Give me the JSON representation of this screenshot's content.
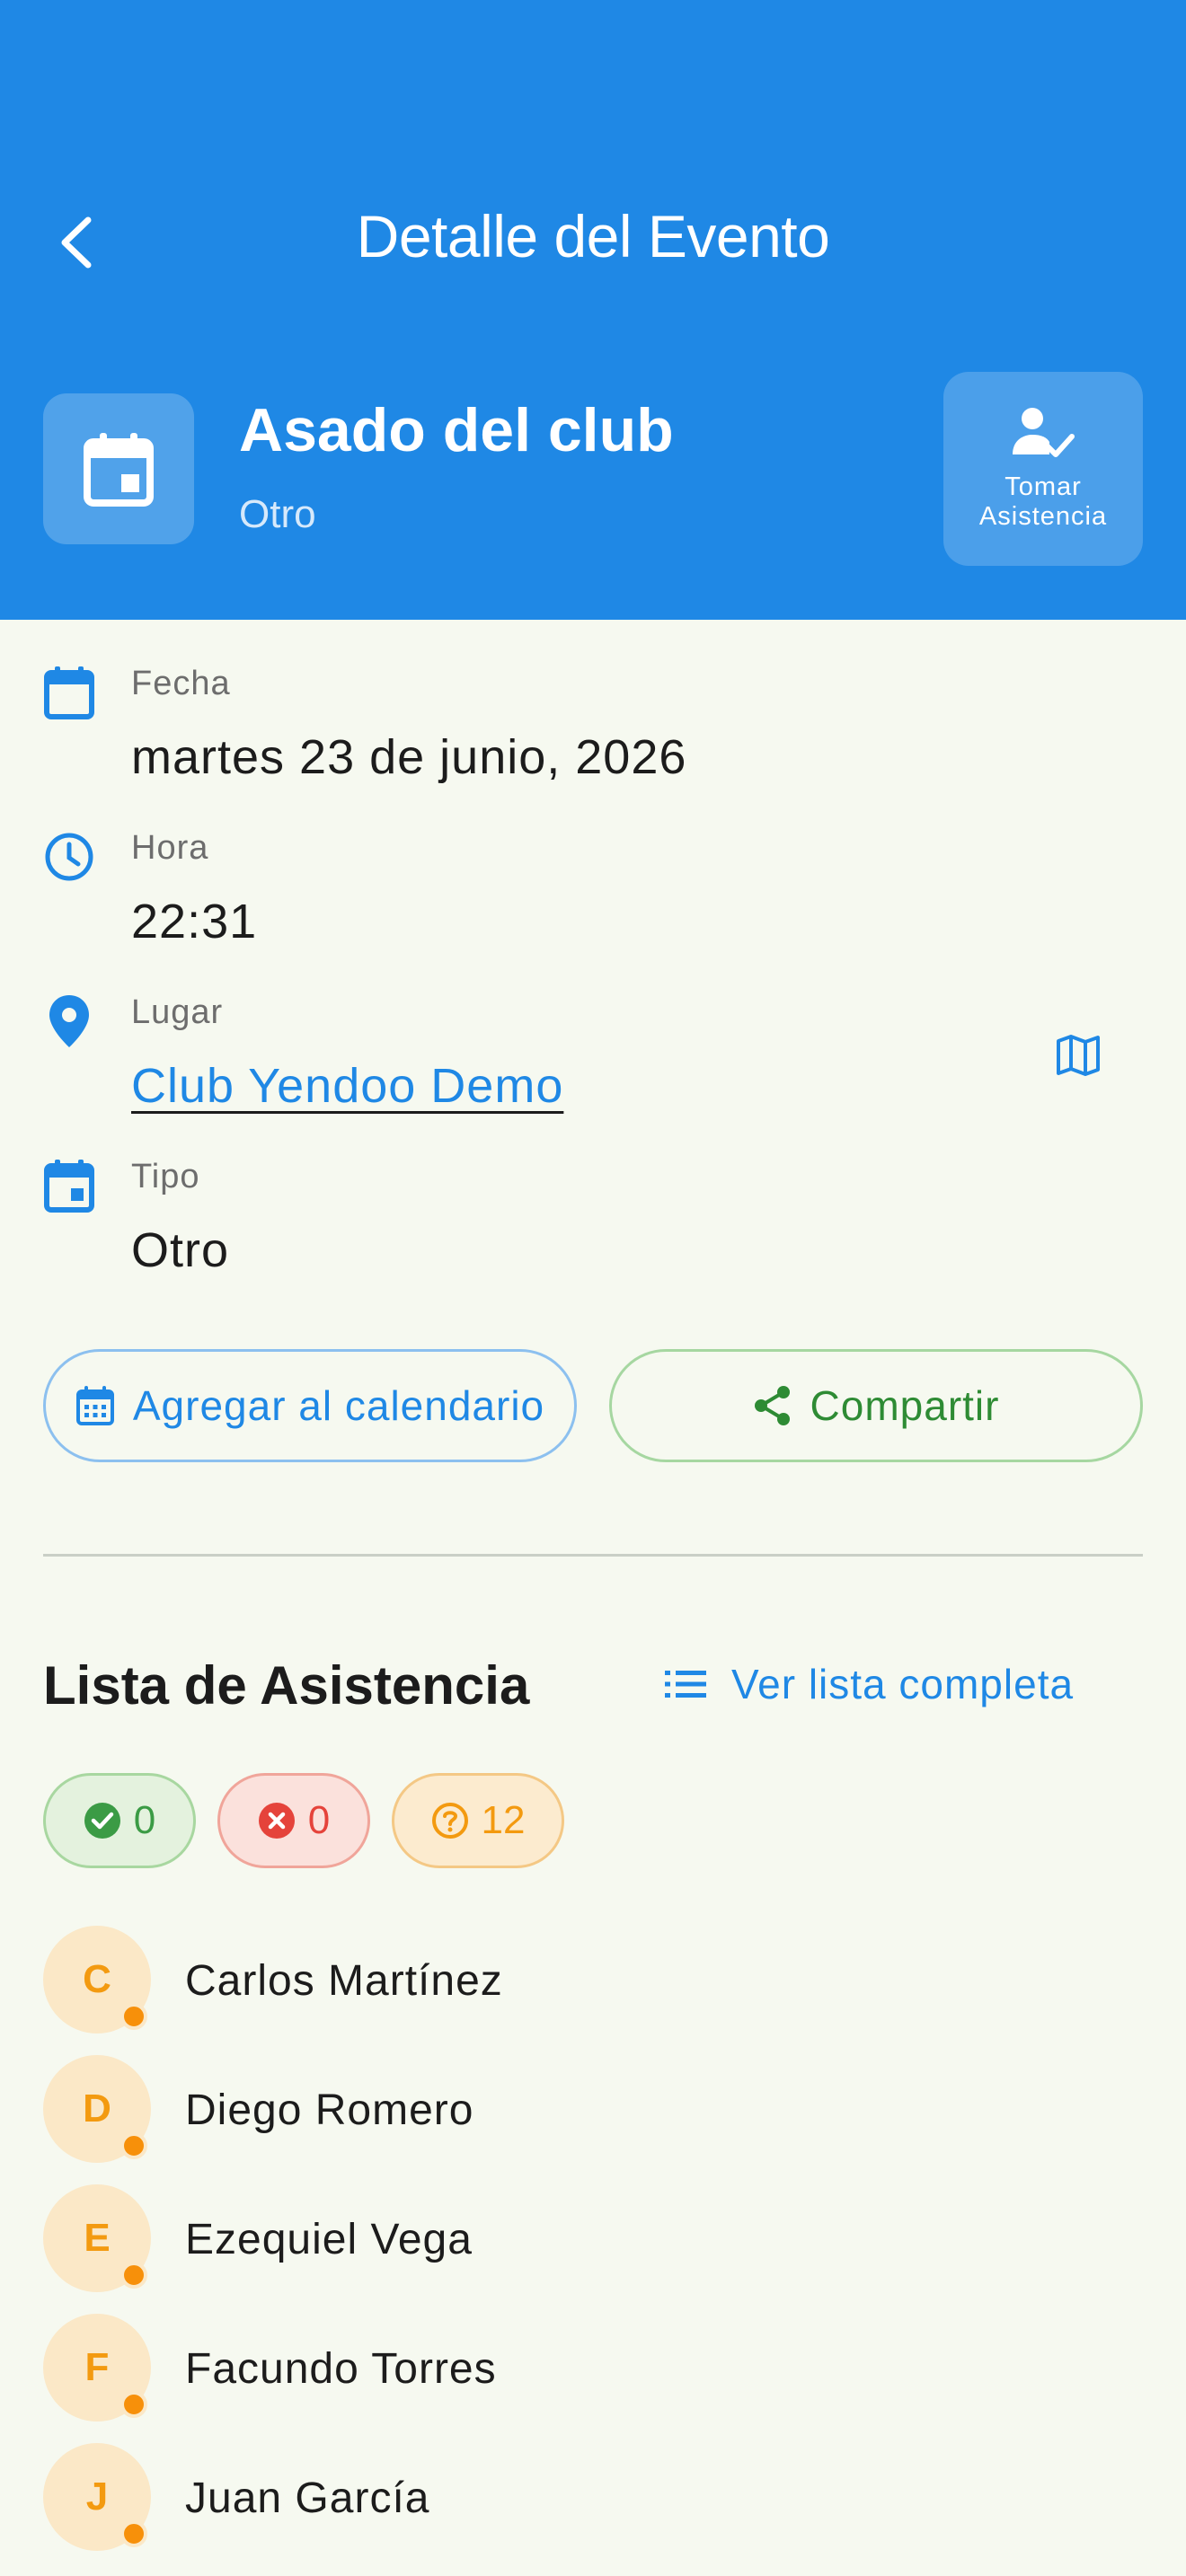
{
  "header": {
    "title": "Detalle del Evento",
    "event_title": "Asado del club",
    "event_type": "Otro",
    "attendance_button": "Tomar Asistencia",
    "color": "#1f88e5"
  },
  "details": {
    "date_label": "Fecha",
    "date_value": "martes 23 de junio, 2026",
    "time_label": "Hora",
    "time_value": "22:31",
    "place_label": "Lugar",
    "place_value": "Club Yendoo Demo",
    "type_label": "Tipo",
    "type_value": "Otro"
  },
  "actions": {
    "calendar_label": "Agregar al calendario",
    "share_label": "Compartir"
  },
  "attendance": {
    "title": "Lista de Asistencia",
    "see_all_label": "Ver lista completa",
    "confirmed_count": "0",
    "declined_count": "0",
    "pending_count": "12",
    "members": [
      {
        "initial": "C",
        "name": "Carlos Martínez",
        "status": "pending"
      },
      {
        "initial": "D",
        "name": "Diego Romero",
        "status": "pending"
      },
      {
        "initial": "E",
        "name": "Ezequiel Vega",
        "status": "pending"
      },
      {
        "initial": "F",
        "name": "Facundo Torres",
        "status": "pending"
      },
      {
        "initial": "J",
        "name": "Juan García",
        "status": "pending"
      }
    ]
  },
  "icons": {
    "back": "chevron-left-icon",
    "event": "calendar-icon",
    "attendance": "person-check-icon",
    "time": "clock-icon",
    "place": "location-pin-icon",
    "map": "map-icon",
    "list": "list-icon",
    "share": "share-icon"
  },
  "colors": {
    "accent": "#1f88e5",
    "success": "#3b9b45",
    "danger": "#e5433b",
    "warning": "#f39a10"
  }
}
